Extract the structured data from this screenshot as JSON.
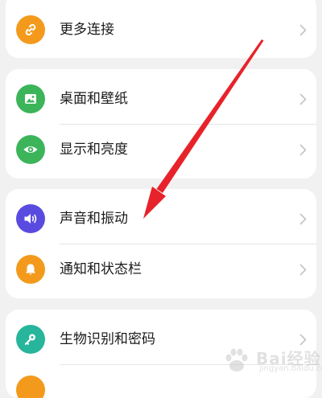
{
  "settings_items": [
    {
      "label": "更多连接",
      "icon": "link-icon",
      "color": "#f39a1d"
    },
    {
      "label": "桌面和壁纸",
      "icon": "wallpaper-icon",
      "color": "#3cb45a"
    },
    {
      "label": "显示和亮度",
      "icon": "eye-icon",
      "color": "#3cb45a"
    },
    {
      "label": "声音和振动",
      "icon": "speaker-icon",
      "color": "#5a4be0"
    },
    {
      "label": "通知和状态栏",
      "icon": "bell-icon",
      "color": "#f39a1d"
    },
    {
      "label": "生物识别和密码",
      "icon": "key-icon",
      "color": "#27b59b"
    },
    {
      "label": "",
      "icon": "app-icon",
      "color": "#f39a1d"
    }
  ],
  "annotation": {
    "arrow_color": "#e8222a",
    "points_to": "声音和振动"
  },
  "watermark": {
    "brand": "Bai",
    "suffix": "经验",
    "url": "jingyan.baidu.com"
  }
}
